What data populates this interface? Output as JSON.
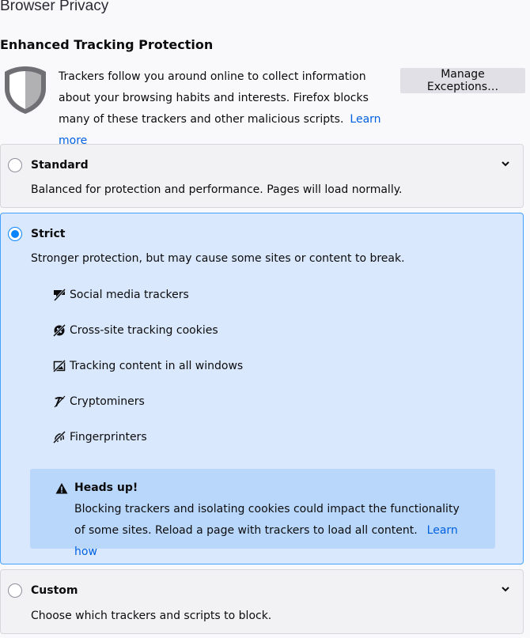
{
  "page": {
    "title": "Browser Privacy",
    "section_title": "Enhanced Tracking Protection"
  },
  "intro": {
    "text": "Trackers follow you around online to collect information about your browsing habits and interests. Firefox blocks many of these trackers and other malicious scripts.",
    "learn_more": "Learn more",
    "manage_button": "Manage Exceptions…"
  },
  "options": {
    "standard": {
      "label": "Standard",
      "description": "Balanced for protection and performance. Pages will load normally.",
      "selected": false
    },
    "strict": {
      "label": "Strict",
      "description": "Stronger protection, but may cause some sites or content to break.",
      "selected": true,
      "features": [
        {
          "icon": "social-tracker-icon",
          "label": "Social media trackers"
        },
        {
          "icon": "cookie-icon",
          "label": "Cross-site tracking cookies"
        },
        {
          "icon": "tracking-content-icon",
          "label": "Tracking content in all windows"
        },
        {
          "icon": "cryptominer-icon",
          "label": "Cryptominers"
        },
        {
          "icon": "fingerprinter-icon",
          "label": "Fingerprinters"
        }
      ],
      "headsup": {
        "title": "Heads up!",
        "body": "Blocking trackers and isolating cookies could impact the functionality of some sites. Reload a page with trackers to load all content.",
        "link": "Learn how"
      }
    },
    "custom": {
      "label": "Custom",
      "description": "Choose which trackers and scripts to block.",
      "selected": false
    }
  },
  "colors": {
    "accent": "#0a84ff",
    "link": "#0060df",
    "selected_card": "#d9e8fd",
    "headsup_bg": "#b9d7fb"
  }
}
